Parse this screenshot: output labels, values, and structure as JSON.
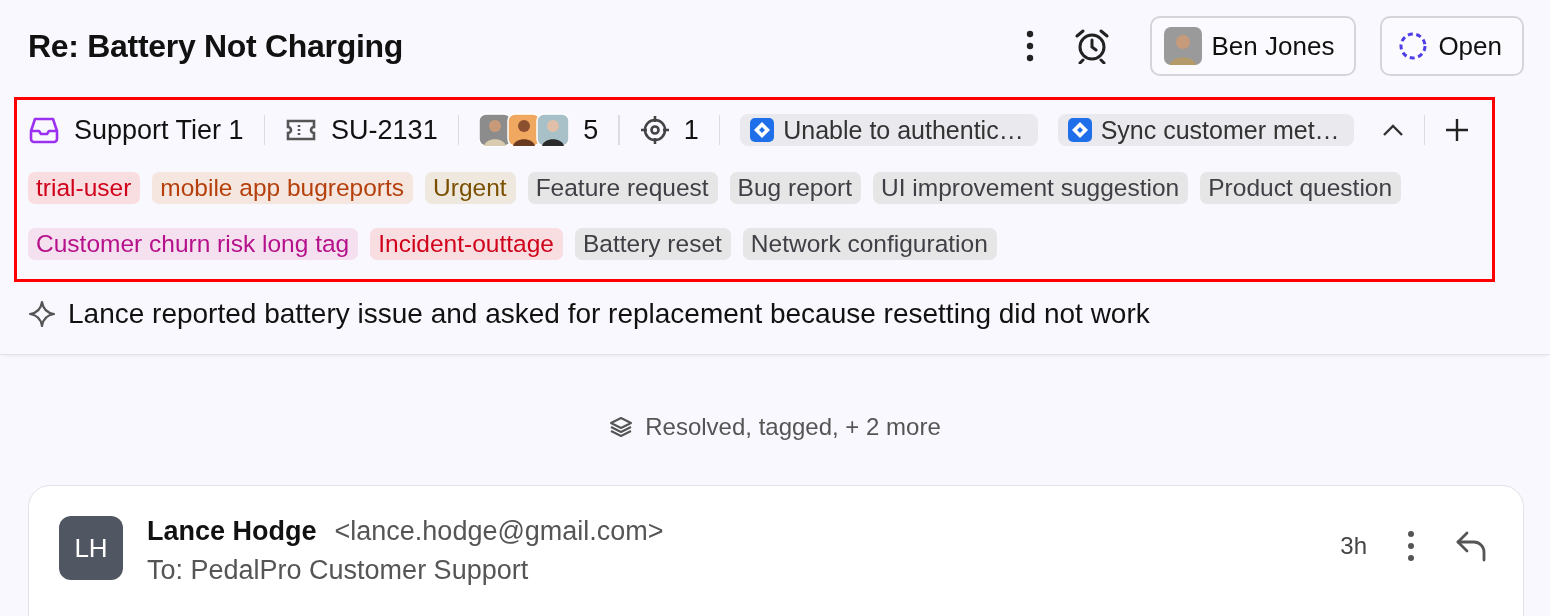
{
  "ticket": {
    "title": "Re: Battery Not Charging"
  },
  "header_actions": {
    "assignee": "Ben Jones",
    "status": "Open"
  },
  "meta": {
    "inbox": "Support Tier 1",
    "ticket_id": "SU-2131",
    "participants_count": "5",
    "focus_count": "1",
    "linked_issues": [
      {
        "title": "Unable to authentic…"
      },
      {
        "title": "Sync customer met…"
      }
    ],
    "expanded": true
  },
  "tag_rows": [
    {
      "tags": [
        {
          "label": "trial-user",
          "color": "#d0021b"
        },
        {
          "label": "mobile app bugreports",
          "color": "#b5400c"
        },
        {
          "label": "Urgent",
          "color": "#7a5000"
        },
        {
          "label": "Feature request",
          "color": "#3f3f46"
        },
        {
          "label": "Bug report",
          "color": "#3f3f46"
        },
        {
          "label": "UI improvement suggestion",
          "color": "#3f3f46"
        },
        {
          "label": "Product question",
          "color": "#3f3f46"
        }
      ]
    },
    {
      "tags": [
        {
          "label": "Customer churn risk long tag",
          "color": "#b5118a"
        },
        {
          "label": "Incident-outtage",
          "color": "#d0021b"
        },
        {
          "label": "Battery reset",
          "color": "#3f3f46"
        },
        {
          "label": "Network configuration",
          "color": "#3f3f46"
        }
      ]
    }
  ],
  "summary": "Lance reported battery issue and asked for replacement because resetting did not work",
  "activity_summary": "Resolved, tagged, + 2 more",
  "message": {
    "initials": "LH",
    "sender": "Lance Hodge",
    "email": "<lance.hodge@gmail.com>",
    "to": "To: PedalPro Customer Support",
    "time": "3h"
  }
}
